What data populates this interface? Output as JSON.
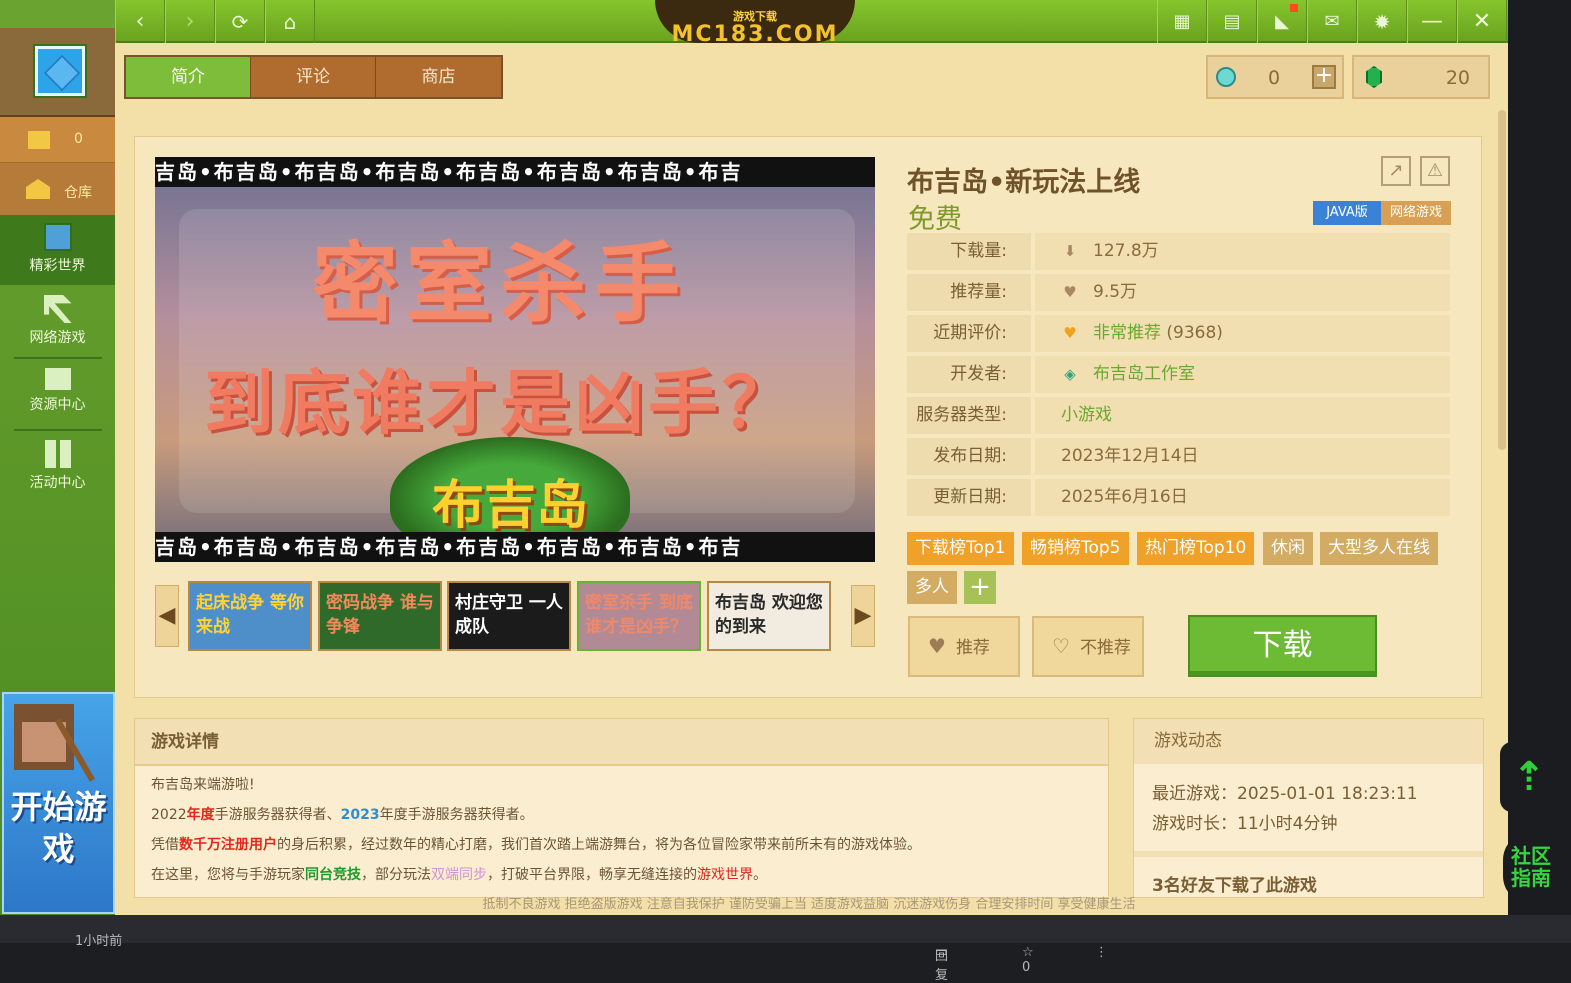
{
  "titlebar": {
    "logo_top": "游戏下载",
    "logo_text": "MC183.COM",
    "nav_icons": [
      "back-icon",
      "forward-icon",
      "refresh-icon",
      "home-icon"
    ],
    "window_icons": [
      "skin-icon",
      "save-icon",
      "announce-icon",
      "mail-icon",
      "settings-icon",
      "minimize-icon",
      "close-icon"
    ]
  },
  "sidebar": {
    "coins": "0",
    "store_label": "仓库",
    "items": [
      {
        "label": "精彩世界",
        "icon": "world-icon",
        "active": true
      },
      {
        "label": "网络游戏",
        "icon": "pickaxe-icon",
        "active": false
      },
      {
        "label": "资源中心",
        "icon": "resource-icon",
        "active": false
      },
      {
        "label": "活动中心",
        "icon": "activity-icon",
        "active": false
      }
    ],
    "start_banner": "开始游戏"
  },
  "tabs": [
    {
      "label": "简介",
      "active": true
    },
    {
      "label": "评论",
      "active": false
    },
    {
      "label": "商店",
      "active": false
    }
  ],
  "currency": {
    "diamond_value": "0",
    "emerald_value": "20"
  },
  "hero": {
    "strip_text": "吉岛•布吉岛•布吉岛•布吉岛•布吉岛•布吉岛•布吉岛•布吉",
    "strip_text_bottom": "吉岛•布吉岛•布吉岛•布吉岛•布吉岛•布吉岛•布吉岛•布吉",
    "headline": "密室杀手",
    "subline": "到底谁才是凶手？",
    "badge": "布吉岛"
  },
  "thumbnails": [
    {
      "text": "起床战争 等你来战",
      "bg": "#4e8fc9",
      "color": "#ffd23a"
    },
    {
      "text": "密码战争 谁与争锋",
      "bg": "#2f6a2a",
      "color": "#f08a5a"
    },
    {
      "text": "村庄守卫 一人成队",
      "bg": "#1b1b1b",
      "color": "#ffffff"
    },
    {
      "text": "密室杀手 到底谁才是凶手？",
      "bg": "#b28a96",
      "color": "#f0886a"
    },
    {
      "text": "布吉岛 欢迎您的到来",
      "bg": "#f2ece0",
      "color": "#2a2a2a"
    }
  ],
  "info": {
    "title": "布吉岛•新玩法上线",
    "price": "免费",
    "badge_java": "JAVA版",
    "badge_net": "网络游戏",
    "rows": [
      {
        "key": "下载量:",
        "value": "127.8万",
        "icon": "⬇",
        "green": false
      },
      {
        "key": "推荐量:",
        "value": "9.5万",
        "icon": "♥",
        "green": false
      },
      {
        "key": "近期评价:",
        "value": "非常推荐",
        "extra": " (9368)",
        "icon": "♥",
        "green": true
      },
      {
        "key": "开发者:",
        "value": "布吉岛工作室",
        "icon": "◈",
        "green": true
      },
      {
        "key": "服务器类型:",
        "value": "小游戏",
        "icon": "",
        "green": true
      },
      {
        "key": "发布日期:",
        "value": "2023年12月14日",
        "icon": "",
        "green": false
      },
      {
        "key": "更新日期:",
        "value": "2025年6月16日",
        "icon": "",
        "green": false
      }
    ],
    "tags": [
      {
        "label": "下载榜Top1",
        "style": "orange"
      },
      {
        "label": "畅销榜Top5",
        "style": "orange"
      },
      {
        "label": "热门榜Top10",
        "style": "orange"
      },
      {
        "label": "休闲",
        "style": "tan"
      },
      {
        "label": "大型多人在线",
        "style": "tan"
      },
      {
        "label": "多人",
        "style": "tan"
      }
    ],
    "recommend_label": "推荐",
    "not_recommend_label": "不推荐",
    "download_label": "下载"
  },
  "details": {
    "title": "游戏详情",
    "line1": "布吉岛来端游啦!",
    "line2_a": "2022",
    "line2_b": "年度",
    "line2_c": "手游服务器获得者、",
    "line2_d": "2023",
    "line2_e": "年度手游服务器获得者。",
    "line3_a": "凭借",
    "line3_b": "数千万注册用户",
    "line3_c": "的身后积累，经过数年的精心打磨，我们首次踏上端游舞台，将为各位冒险家带来前所未有的游戏体验。",
    "line4_a": "在这里，您将与手游玩家",
    "line4_b": "同台竞技",
    "line4_c": "，部分玩法",
    "line4_d": "双端同步",
    "line4_e": "，打破平台界限，畅享无缝连接的",
    "line4_f": "游戏世界",
    "line4_g": "。"
  },
  "dynamics": {
    "title": "游戏动态",
    "recent": "最近游戏：2025-01-01 18:23:11",
    "duration": "游戏时长：11小时4分钟",
    "friends": "3名好友下载了此游戏"
  },
  "footer": "抵制不良游戏 拒绝盗版游戏 注意自我保护 谨防受骗上当 适度游戏益脑 沉迷游戏伤身 合理安排时间 享受健康生活",
  "floating": {
    "guide": "社区指南",
    "bottom_left": "1小时前",
    "bottom_reply": "回复"
  }
}
